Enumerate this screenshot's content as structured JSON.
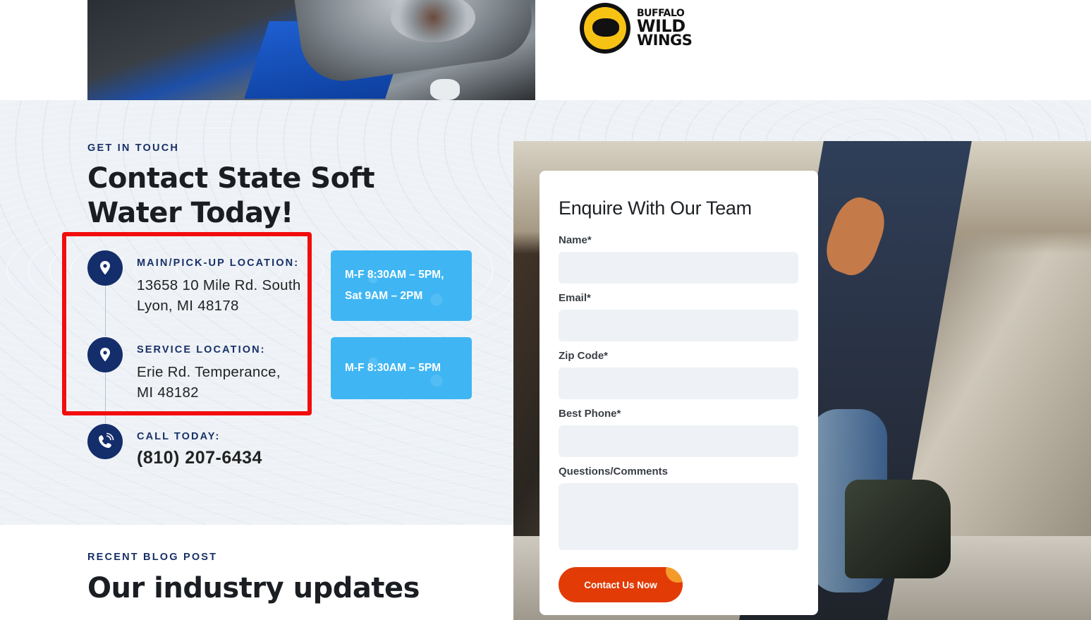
{
  "top": {
    "partner_logo": {
      "line1": "BUFFALO",
      "line2": "WILD",
      "line3": "WINGS"
    }
  },
  "contact": {
    "eyebrow": "GET IN TOUCH",
    "heading_line1": "Contact State Soft",
    "heading_line2": "Water Today!",
    "locations": [
      {
        "label": "MAIN/PICK-UP LOCATION:",
        "address_line1": "13658 10 Mile Rd. South",
        "address_line2": "Lyon, MI 48178",
        "hours_line1": "M-F 8:30AM – 5PM,",
        "hours_line2": "Sat 9AM – 2PM"
      },
      {
        "label": "SERVICE LOCATION:",
        "address_line1": "Erie Rd. Temperance,",
        "address_line2": "MI 48182",
        "hours_line1": "M-F 8:30AM – 5PM"
      }
    ],
    "call": {
      "label": "CALL TODAY:",
      "phone": "(810) 207-6434"
    },
    "highlight_color": "#f20d0d",
    "accent_color": "#142d6b",
    "hours_color": "#3fb6f3"
  },
  "form": {
    "title": "Enquire With Our Team",
    "fields": [
      {
        "label": "Name*",
        "value": ""
      },
      {
        "label": "Email*",
        "value": ""
      },
      {
        "label": "Zip Code*",
        "value": ""
      },
      {
        "label": "Best Phone*",
        "value": ""
      },
      {
        "label": "Questions/Comments",
        "value": ""
      }
    ],
    "submit_label": "Contact Us Now",
    "button_color": "#e23b06"
  },
  "blog": {
    "eyebrow": "RECENT BLOG POST",
    "heading": "Our industry updates"
  },
  "icons": {
    "location": "map-pin-icon",
    "phone": "phone-icon"
  }
}
